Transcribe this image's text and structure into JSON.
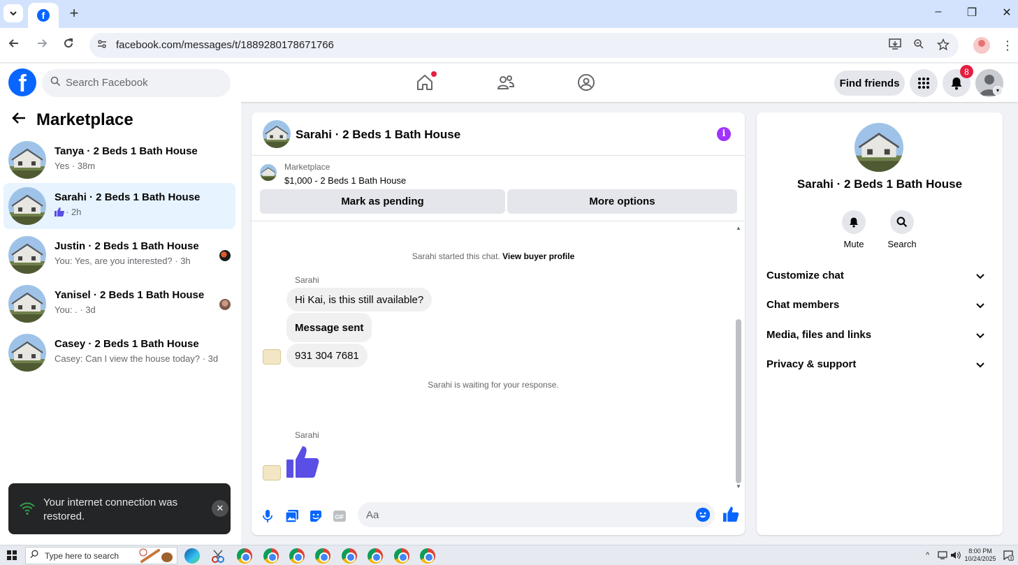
{
  "browser": {
    "url": "facebook.com/messages/t/1889280178671766",
    "new_tab": "+",
    "minimize": "–",
    "restore": "❐",
    "close": "✕"
  },
  "fb_header": {
    "search_placeholder": "Search Facebook",
    "find_friends": "Find friends",
    "notification_count": "8"
  },
  "left_panel": {
    "title": "Marketplace",
    "conversations": [
      {
        "title": "Tanya · 2 Beds 1 Bath House",
        "subtitle": "Yes · 38m",
        "active": false
      },
      {
        "title": "Sarahi · 2 Beds 1 Bath House",
        "subtitle": "· 2h",
        "active": true
      },
      {
        "title": "Justin · 2 Beds 1 Bath House",
        "subtitle": "You: Yes, are you interested? · 3h",
        "active": false
      },
      {
        "title": "Yanisel · 2 Beds 1 Bath House",
        "subtitle": "You: . · 3d",
        "active": false
      },
      {
        "title": "Casey · 2 Beds 1 Bath House",
        "subtitle": "Casey: Can I view the house today? · 3d",
        "active": false
      }
    ]
  },
  "toast": {
    "text": "Your internet connection was restored.",
    "close": "✕"
  },
  "chat": {
    "title": "Sarahi · 2 Beds 1 Bath House",
    "listing_category": "Marketplace",
    "listing_title": "$1,000 - 2 Beds 1 Bath House",
    "mark_pending": "Mark as pending",
    "more_options": "More options",
    "started_text": "Sarahi started this chat.",
    "view_profile": "View buyer profile",
    "sender_1": "Sarahi",
    "messages": [
      "Hi Kai, is this still available?",
      "Message sent",
      "931 304 7681"
    ],
    "waiting_text": "Sarahi is waiting for your response.",
    "sender_2": "Sarahi",
    "composer_placeholder": "Aa"
  },
  "right_panel": {
    "title": "Sarahi · 2 Beds 1 Bath House",
    "mute": "Mute",
    "search": "Search",
    "sections": [
      "Customize chat",
      "Chat members",
      "Media, files and links",
      "Privacy & support"
    ]
  },
  "taskbar": {
    "search_text": "Type here to search",
    "time": "8:00 PM",
    "date": "10/24/2025",
    "notif_count": "3"
  },
  "colors": {
    "facebook_blue": "#0866ff",
    "messenger_purple": "#a033ff",
    "like_purple": "#5b4ee6",
    "active_conversation": "#e7f3ff",
    "notification_red": "#e41e3f"
  }
}
